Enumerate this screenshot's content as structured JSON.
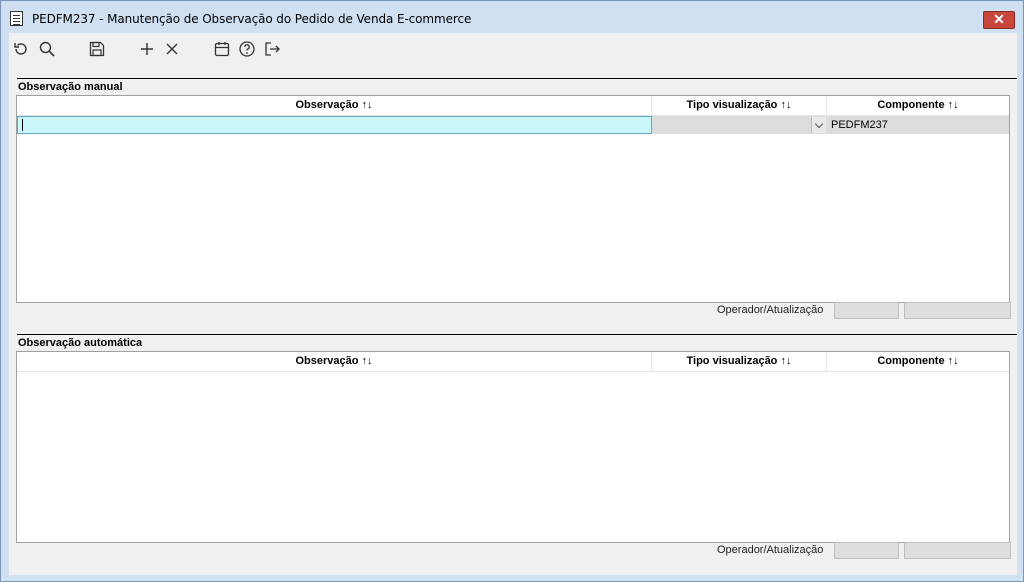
{
  "window": {
    "title": "PEDFM237 - Manutenção de Observação do Pedido de Venda E-commerce",
    "close_label": "✕"
  },
  "toolbar": {
    "icons": [
      "refresh-icon",
      "search-icon",
      "save-icon",
      "add-icon",
      "delete-icon",
      "calendar-icon",
      "help-icon",
      "exit-icon"
    ]
  },
  "manual": {
    "title": "Observação manual",
    "columns": [
      "Observação ↑↓",
      "Tipo visualização ↑↓",
      "Componente ↑↓"
    ],
    "rows": [
      {
        "observacao": "",
        "tipo": "",
        "componente": "PEDFM237"
      }
    ],
    "footer_label": "Operador/Atualização",
    "operador": "",
    "atualizacao": ""
  },
  "auto": {
    "title": "Observação automática",
    "columns": [
      "Observação ↑↓",
      "Tipo visualização ↑↓",
      "Componente ↑↓"
    ],
    "footer_label": "Operador/Atualização",
    "operador": "",
    "atualizacao": ""
  },
  "colors": {
    "titlebar": "#cfe0f3",
    "close": "#c9463d",
    "active_cell": "#c9f7fb"
  }
}
